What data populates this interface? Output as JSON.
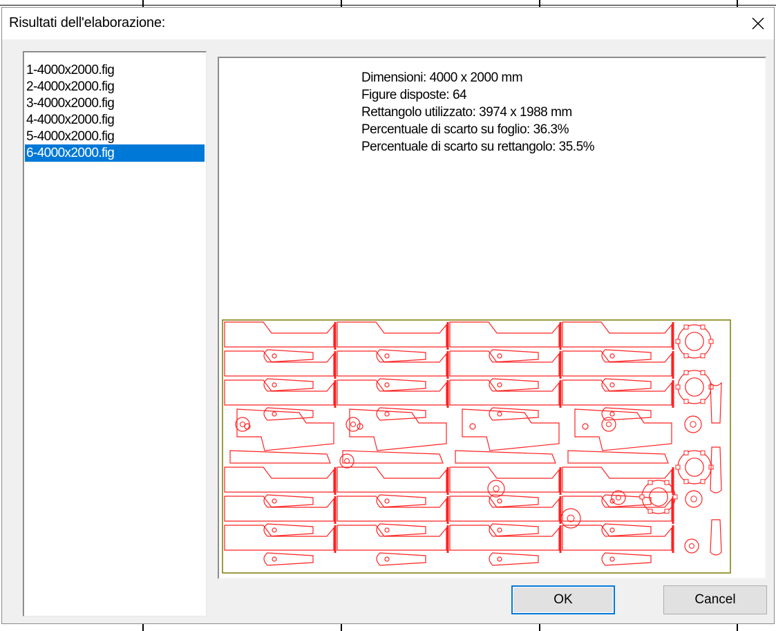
{
  "dialog": {
    "title": "Risultati dell'elaborazione:",
    "close_icon": "close-icon"
  },
  "results_list": {
    "items": [
      "1-4000x2000.fig",
      "2-4000x2000.fig",
      "3-4000x2000.fig",
      "4-4000x2000.fig",
      "5-4000x2000.fig",
      "6-4000x2000.fig"
    ],
    "selected": "6-4000x2000.fig"
  },
  "info": {
    "dimensions": "Dimensioni: 4000 x 2000 mm",
    "figures": "Figure disposte: 64",
    "rectangle": "Rettangolo utilizzato: 3974 x 1988 mm",
    "waste_sheet": "Percentuale di scarto su foglio: 36.3%",
    "waste_rect": "Percentuale di scarto su rettangolo: 35.5%"
  },
  "nesting": {
    "sheet_color": "#7a7a00",
    "part_color": "#ff2020",
    "rows": 8,
    "columns": 4
  },
  "buttons": {
    "ok": "OK",
    "cancel": "Cancel"
  },
  "colors": {
    "selection": "#0078d7",
    "dialog_bg": "#f0f0f0"
  }
}
